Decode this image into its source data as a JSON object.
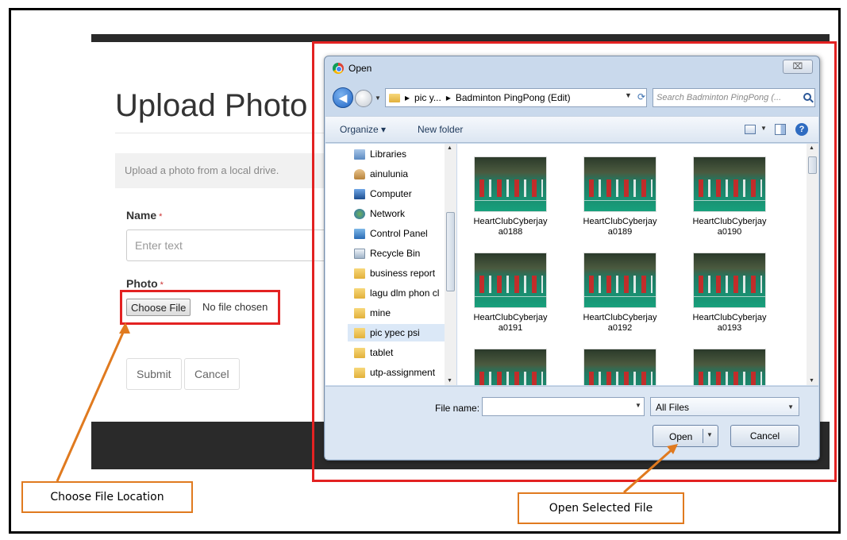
{
  "webpage": {
    "title": "Upload Photo",
    "info_text": "Upload a photo from a local drive.",
    "name_label": "Name",
    "required_marker": "*",
    "name_placeholder": "Enter text",
    "photo_label": "Photo",
    "choose_file_label": "Choose File",
    "no_file_text": "No file chosen",
    "submit_label": "Submit",
    "cancel_label": "Cancel"
  },
  "dialog": {
    "title": "Open",
    "close_glyph": "⌧",
    "address_segments": [
      "pic y...",
      "Badminton PingPong (Edit)"
    ],
    "address_separator": "▸",
    "search_placeholder": "Search Badminton PingPong (...",
    "toolbar": {
      "organize_label": "Organize ▾",
      "new_folder_label": "New folder",
      "help_glyph": "?"
    },
    "nav_items": [
      {
        "label": "Libraries",
        "icon": "libraries-icon"
      },
      {
        "label": "ainulunia",
        "icon": "user-icon"
      },
      {
        "label": "Computer",
        "icon": "computer-icon"
      },
      {
        "label": "Network",
        "icon": "network-icon"
      },
      {
        "label": "Control Panel",
        "icon": "control-panel-icon"
      },
      {
        "label": "Recycle Bin",
        "icon": "recycle-bin-icon"
      },
      {
        "label": "business report",
        "icon": "folder-icon"
      },
      {
        "label": "lagu dlm phon cl",
        "icon": "folder-icon"
      },
      {
        "label": "mine",
        "icon": "folder-icon"
      },
      {
        "label": "pic ypec psi",
        "icon": "folder-icon",
        "selected": true
      },
      {
        "label": "tablet",
        "icon": "folder-icon"
      },
      {
        "label": "utp-assignment",
        "icon": "folder-icon"
      }
    ],
    "files": [
      {
        "name": "HeartClubCyberjaya0188"
      },
      {
        "name": "HeartClubCyberjaya0189"
      },
      {
        "name": "HeartClubCyberjaya0190"
      },
      {
        "name": "HeartClubCyberjaya0191"
      },
      {
        "name": "HeartClubCyberjaya0192"
      },
      {
        "name": "HeartClubCyberjaya0193"
      },
      {
        "name": ""
      },
      {
        "name": ""
      },
      {
        "name": ""
      }
    ],
    "file_name_label": "File name:",
    "file_name_value": "",
    "file_type_value": "All Files",
    "open_label": "Open",
    "cancel_label": "Cancel"
  },
  "callouts": {
    "choose_file_location": "Choose File Location",
    "open_selected_file": "Open Selected File"
  },
  "colors": {
    "highlight": "#e32222",
    "callout_border": "#e07a1f"
  }
}
